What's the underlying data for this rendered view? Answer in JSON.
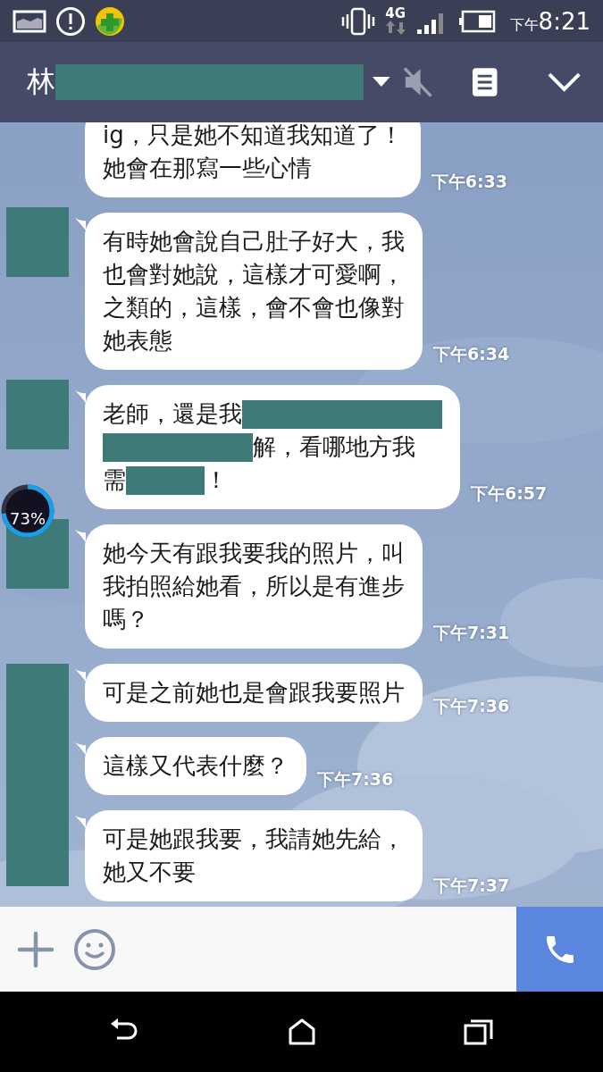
{
  "status_bar": {
    "time_prefix": "下午",
    "time": "8:21",
    "network": "4G"
  },
  "header": {
    "title": "林",
    "muted": true
  },
  "messages": [
    {
      "kind": "plain",
      "lines": [
        [
          {
            "kind": "text",
            "text": "ig，只是她不知道我知道了！"
          }
        ],
        [
          {
            "kind": "text",
            "text": "她會在那寫一些心情"
          }
        ]
      ],
      "time": "下午6:33"
    },
    {
      "kind": "covered",
      "lines": [
        [
          {
            "kind": "text",
            "text": "有時她會說自己肚子好大，我"
          }
        ],
        [
          {
            "kind": "text",
            "text": "也會對她說，這樣才可愛啊，"
          }
        ],
        [
          {
            "kind": "text",
            "text": "之類的，這樣，會不會也像對"
          }
        ],
        [
          {
            "kind": "text",
            "text": "她表態"
          }
        ]
      ],
      "time": "下午6:34"
    },
    {
      "kind": "covered",
      "lines": [
        [
          {
            "kind": "text",
            "text": "老師，還是我"
          },
          {
            "kind": "redaction"
          }
        ],
        [
          {
            "kind": "redaction"
          },
          {
            "kind": "text",
            "text": "解，看哪地方我"
          }
        ],
        [
          {
            "kind": "text",
            "text": "需"
          },
          {
            "kind": "redaction"
          },
          {
            "kind": "text",
            "text": "！"
          }
        ]
      ],
      "time": "下午6:57"
    },
    {
      "kind": "covered",
      "lines": [
        [
          {
            "kind": "text",
            "text": "她今天有跟我要我的照片，叫"
          }
        ],
        [
          {
            "kind": "text",
            "text": "我拍照給她看，所以是有進步"
          }
        ],
        [
          {
            "kind": "text",
            "text": "嗎？"
          }
        ]
      ],
      "time": "下午7:31"
    },
    {
      "kind": "grouped",
      "lines": [
        [
          {
            "kind": "text",
            "text": "可是之前她也是會跟我要照片"
          }
        ]
      ],
      "time": "下午7:36"
    },
    {
      "kind": "grouped",
      "lines": [
        [
          {
            "kind": "text",
            "text": "這樣又代表什麼？"
          }
        ]
      ],
      "time": "下午7:36"
    },
    {
      "kind": "grouped",
      "lines": [
        [
          {
            "kind": "text",
            "text": "可是她跟我要，我請她先給，"
          }
        ],
        [
          {
            "kind": "text",
            "text": "她又不要"
          }
        ]
      ],
      "time": "下午7:37"
    }
  ],
  "floating_widget": {
    "text": "73%"
  }
}
